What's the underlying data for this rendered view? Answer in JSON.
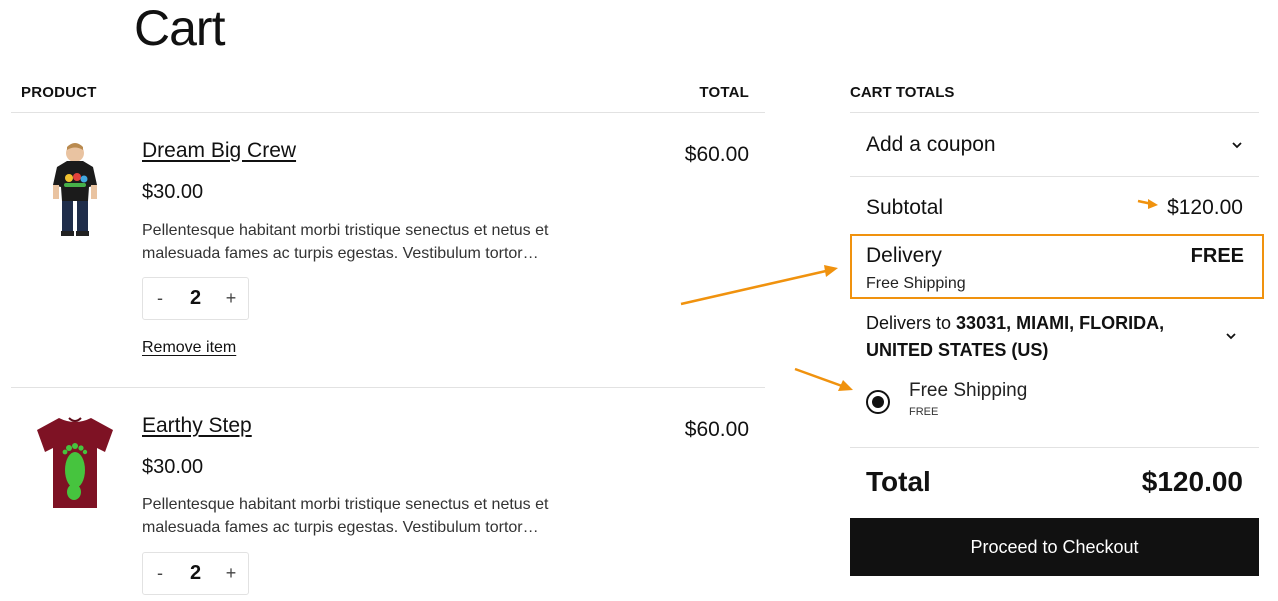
{
  "page": {
    "title": "Cart"
  },
  "table": {
    "product_header": "PRODUCT",
    "total_header": "TOTAL"
  },
  "items": [
    {
      "name": "Dream Big Crew",
      "price": "$30.00",
      "description": "Pellentesque habitant morbi tristique senectus et netus et malesuada fames ac turpis egestas. Vestibulum tortor…",
      "quantity": "2",
      "qty_minus": "-",
      "qty_plus": "+",
      "remove_label": "Remove item",
      "total": "$60.00",
      "image": "kid-black-tshirt-image"
    },
    {
      "name": "Earthy Step",
      "price": "$30.00",
      "description": "Pellentesque habitant morbi tristique senectus et netus et malesuada fames ac turpis egestas. Vestibulum tortor…",
      "quantity": "2",
      "qty_minus": "-",
      "qty_plus": "+",
      "total": "$60.00",
      "image": "maroon-footprint-tshirt-image"
    }
  ],
  "totals": {
    "heading": "CART TOTALS",
    "coupon_label": "Add a coupon",
    "subtotal_label": "Subtotal",
    "subtotal_value": "$120.00",
    "delivery_label": "Delivery",
    "delivery_value": "FREE",
    "delivery_method": "Free Shipping",
    "delivers_to_prefix": "Delivers to",
    "delivers_to_address": "33031, MIAMI, FLORIDA, UNITED STATES (US)",
    "shipping_option_name": "Free Shipping",
    "shipping_option_price": "FREE",
    "total_label": "Total",
    "total_value": "$120.00",
    "checkout_label": "Proceed to Checkout"
  },
  "colors": {
    "annotation": "#f0920e",
    "button_bg": "#111111",
    "divider": "#e2e2e2"
  }
}
